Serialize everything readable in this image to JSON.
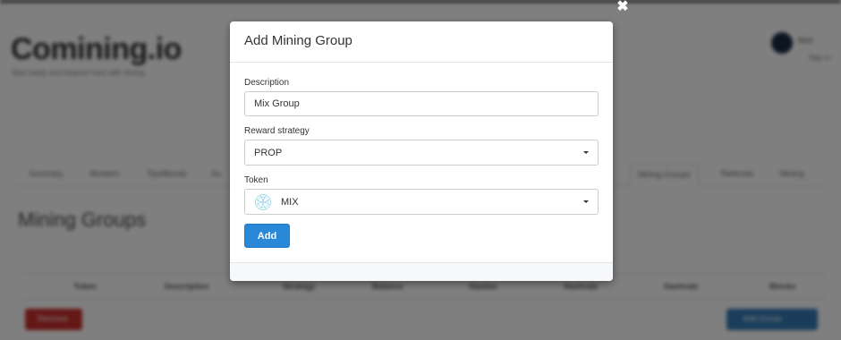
{
  "background": {
    "brand": "Comining.io",
    "tagline": "Start easily and frequent mine with mining",
    "user": {
      "name": "Moir",
      "sub": "Sign in"
    },
    "tabs": [
      "Summary",
      "Workers",
      "Tips/Bonds",
      "Su",
      "Mining Groups",
      "Referrals",
      "Mining"
    ],
    "page_heading": "Mining Groups",
    "table_headers": [
      "Token",
      "Description",
      "Strategy",
      "Balance",
      "Hashes",
      "Hashrate",
      "Hashrate",
      "Blocks"
    ],
    "remove_label": "Remove",
    "add_group_label": "Add Group"
  },
  "modal": {
    "close_icon": "close-icon",
    "title": "Add Mining Group",
    "description": {
      "label": "Description",
      "value": "Mix Group"
    },
    "reward_strategy": {
      "label": "Reward strategy",
      "value": "PROP"
    },
    "token": {
      "label": "Token",
      "value": "MIX",
      "icon": "mix-token-icon"
    },
    "add_label": "Add"
  },
  "colors": {
    "primary": "#2a88d8",
    "danger": "#c9302c",
    "overlay": "rgba(0,0,0,0.5)"
  }
}
